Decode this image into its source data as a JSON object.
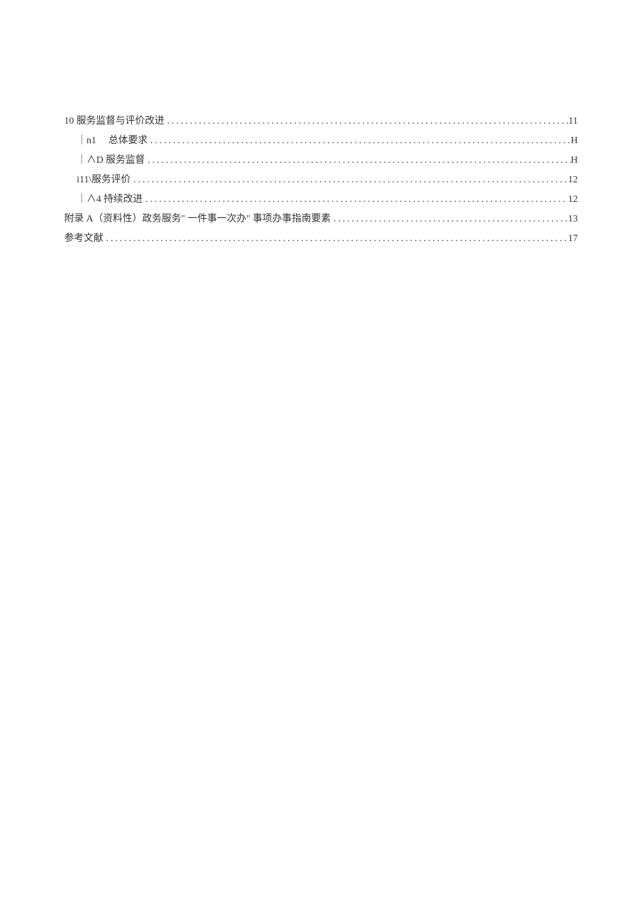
{
  "toc": [
    {
      "indent": 0,
      "label": "10 服务监督与评价改进",
      "page": "11"
    },
    {
      "indent": 1,
      "label": "｜n1　 总体要求",
      "page": "H"
    },
    {
      "indent": 1,
      "label": "｜∧D 服务监督",
      "page": "H"
    },
    {
      "indent": 1,
      "label": "i11\\服务评价",
      "page": "12"
    },
    {
      "indent": 1,
      "label": "｜∧4 持续改进",
      "page": "12"
    },
    {
      "indent": 0,
      "label": "附录 A（资料性）政务服务\" 一件事一次办\" 事项办事指南要素",
      "page": "13"
    },
    {
      "indent": 0,
      "label": "参考文献",
      "page": "17"
    }
  ]
}
